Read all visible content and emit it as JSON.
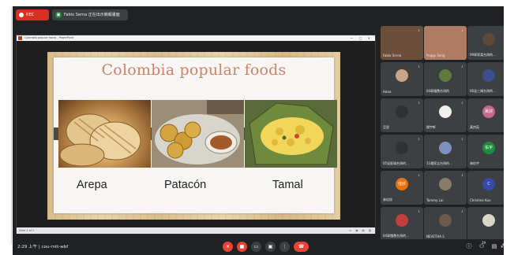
{
  "topbar": {
    "recording_label": "REC",
    "presenter_label": "Fabio Serna 正在出示簡報畫面"
  },
  "share_window": {
    "title": "Colombia popular foods - PowerPoint",
    "controls": "— ▢ ✕",
    "status_left": "Slide 1 of 1",
    "status_right": "▭ ▦ ▤ ▧"
  },
  "slide": {
    "title": "Colombia popular foods",
    "foods": [
      {
        "name": "Arepa"
      },
      {
        "name": "Patacón"
      },
      {
        "name": "Tamal"
      }
    ]
  },
  "participants": [
    {
      "name": "Fabio Serna",
      "color": "#6b4f3a",
      "initial": ""
    },
    {
      "name": "Peggy Song",
      "color": "#b07a63",
      "initial": ""
    },
    {
      "name": "09郭家柔台灣的...",
      "color": "#5d4a3a",
      "initial": ""
    },
    {
      "name": "Hana",
      "color": "#c9a58a",
      "initial": ""
    },
    {
      "name": "04郭韻喬台灣的",
      "color": "#5f7a3c",
      "initial": ""
    },
    {
      "name": "06吳三娟台灣的...",
      "color": "#3a4f8c",
      "initial": ""
    },
    {
      "name": "亞里",
      "color": "#2f3133",
      "initial": ""
    },
    {
      "name": "楊宇軒",
      "color": "#f2efe8",
      "initial": ""
    },
    {
      "name": "黃詩茹",
      "color": "#c46a86",
      "initial": "黃詩"
    },
    {
      "name": "05吳鈺珈台灣的...",
      "color": "#2f3133",
      "initial": ""
    },
    {
      "name": "11楊家吉台灣的...",
      "color": "#7d8fbf",
      "initial": ""
    },
    {
      "name": "林佑宇",
      "color": "#1e8e3e",
      "initial": "佑宇"
    },
    {
      "name": "林佳欣",
      "color": "#e8710a",
      "initial": "佳欣"
    },
    {
      "name": "Tammy Lai",
      "color": "#8a7a6a",
      "initial": ""
    },
    {
      "name": "Christine Kuo",
      "color": "#3949ab",
      "initial": "C"
    },
    {
      "name": "04郭韻喬台灣的...",
      "color": "#c43e3e",
      "initial": ""
    },
    {
      "name": "NEVETHA S",
      "color": "#6d5a4b",
      "initial": ""
    },
    {
      "name": "",
      "color": "#dcd6c8",
      "initial": ""
    }
  ],
  "bottombar": {
    "time": "2:29 上午",
    "meeting_code": "cou-rntt-wbf",
    "people_count": "29"
  },
  "colors": {
    "meet_bg": "#202124",
    "tile_bg": "#3c4043",
    "danger": "#ea4335",
    "slide_title": "#c9836a"
  }
}
